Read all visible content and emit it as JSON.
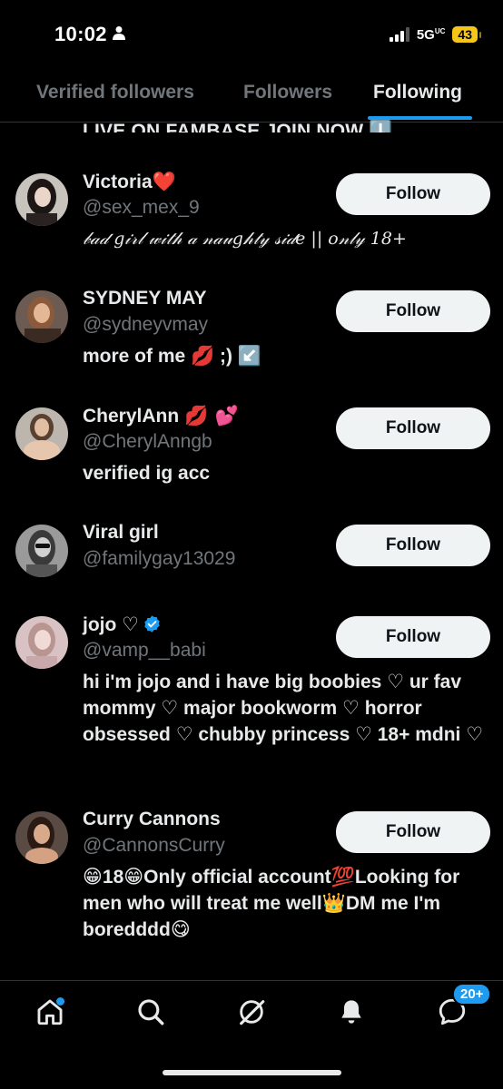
{
  "status_bar": {
    "time": "10:02",
    "network": "5G",
    "network_suffix": "UC",
    "battery": "43"
  },
  "tabs": [
    {
      "label": "Verified followers",
      "active": false
    },
    {
      "label": "Followers",
      "active": false
    },
    {
      "label": "Following",
      "active": true
    }
  ],
  "cut_off_text": "LIVE ON FAMBASE JOIN NOW ⬇️",
  "users": [
    {
      "name": "Victoria",
      "name_emoji": "❤️",
      "handle": "@sex_mex_9",
      "bio": "𝒷𝒶𝒹 𝑔𝒾𝓇𝓁 𝓌𝒾𝓉𝒽 𝒶 𝓃𝒶𝓊𝑔𝒽𝓉𝓎 𝓈𝒾𝒹𝑒 || 𝑜𝓃𝓁𝓎 18+",
      "button": "Follow"
    },
    {
      "name": "SYDNEY MAY",
      "name_emoji": "",
      "handle": "@sydneyvmay",
      "bio": "more of me 💋 ;) ↙️",
      "button": "Follow"
    },
    {
      "name": "CherylAnn",
      "name_emoji": "💋 💕",
      "handle": "@CherylAnngb",
      "bio": "verified ig acc",
      "button": "Follow"
    },
    {
      "name": "Viral girl",
      "name_emoji": "",
      "handle": "@familygay13029",
      "bio": "",
      "button": "Follow"
    },
    {
      "name": "jojo ♡",
      "name_emoji": "",
      "handle": "@vamp__babi",
      "bio": "hi i'm jojo and i have big boobies ♡ ur fav mommy ♡ major bookworm ♡ horror obsessed ♡ chubby princess ♡ 18+ mdni ♡",
      "button": "Follow",
      "verified": true
    },
    {
      "name": "Curry Cannons",
      "name_emoji": "",
      "handle": "@CannonsCurry",
      "bio": "😁18😁Only official account💯Looking for men who will treat me well👑DM me I'm boredddd😋",
      "button": "Follow"
    }
  ],
  "bottom_nav": {
    "notification_count": "20+"
  },
  "colors": {
    "background": "#000000",
    "accent": "#1d9bf0",
    "muted_text": "#71767b",
    "follow_button": "#eff3f4"
  }
}
